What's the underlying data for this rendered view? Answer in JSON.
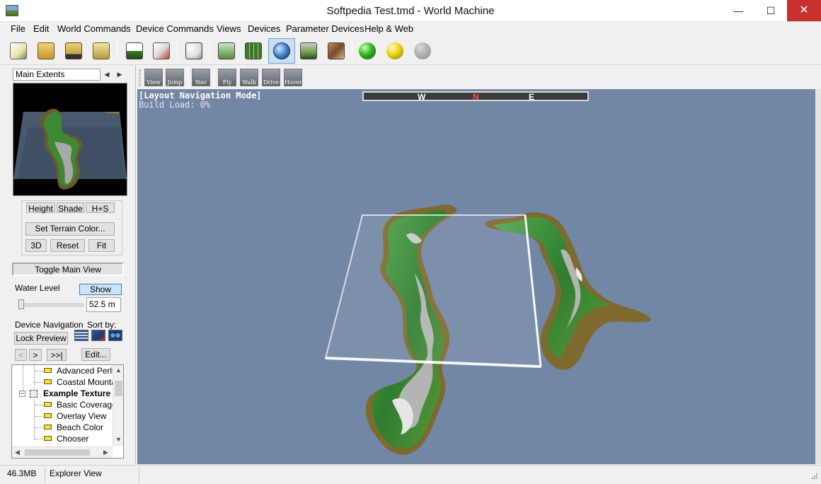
{
  "window": {
    "title": "Softpedia Test.tmd - World Machine",
    "minimize": "—",
    "maximize": "☐",
    "close": "✕"
  },
  "menu": [
    "File",
    "Edit",
    "World Commands",
    "Device Commands",
    "Views",
    "Devices",
    "Parameter Devices",
    "Help & Web"
  ],
  "toolbar": {
    "icons": [
      "new-file-icon",
      "open-folder-icon",
      "save-disk-icon",
      "export-icon",
      "build-icon",
      "build-settings-icon",
      "random-seed-dice-icon",
      "device-view-icon",
      "layout-grid-icon",
      "3d-preview-globe-icon",
      "terrain-icon",
      "texture-icon",
      "status-green-icon",
      "status-yellow-icon",
      "status-gray-icon"
    ]
  },
  "left_panel": {
    "extents": "Main Extents",
    "buttons": {
      "height": "Height",
      "shade": "Shade",
      "hs": "H+S",
      "set_terrain_color": "Set Terrain Color...",
      "three_d": "3D",
      "reset": "Reset",
      "fit": "Fit",
      "toggle_main_view": "Toggle Main View",
      "show": "Show",
      "lock_preview": "Lock Preview",
      "first": "<",
      "next": ">",
      "last": ">>|",
      "edit": "Edit..."
    },
    "water_level_label": "Water Level",
    "water_level_value": "52.5 m",
    "water_level_fraction": 0.02,
    "device_navigation_label": "Device Navigation",
    "sort_by_label": "Sort by:",
    "tree": [
      {
        "label": "Advanced Perlin",
        "bold": false,
        "indent": 1
      },
      {
        "label": "Coastal Mountain",
        "bold": false,
        "indent": 1
      },
      {
        "label": "Example Texture",
        "bold": true,
        "indent": 0
      },
      {
        "label": "Basic Coverage",
        "bold": false,
        "indent": 1
      },
      {
        "label": "Overlay View",
        "bold": false,
        "indent": 1
      },
      {
        "label": "Beach Color",
        "bold": false,
        "indent": 1
      },
      {
        "label": "Chooser",
        "bold": false,
        "indent": 1
      }
    ]
  },
  "view_toolbar": {
    "buttons": [
      "View",
      "Jump",
      "Nav",
      "Fly",
      "Walk",
      "Drive",
      "Hover"
    ]
  },
  "viewport": {
    "mode": "[Layout Navigation Mode]",
    "build_load": "Build Load: 0%",
    "compass": {
      "w": "W",
      "n": "N",
      "e": "E"
    },
    "background_color": "#7187a5"
  },
  "status": {
    "memory": "46.3MB",
    "view": "Explorer View"
  }
}
